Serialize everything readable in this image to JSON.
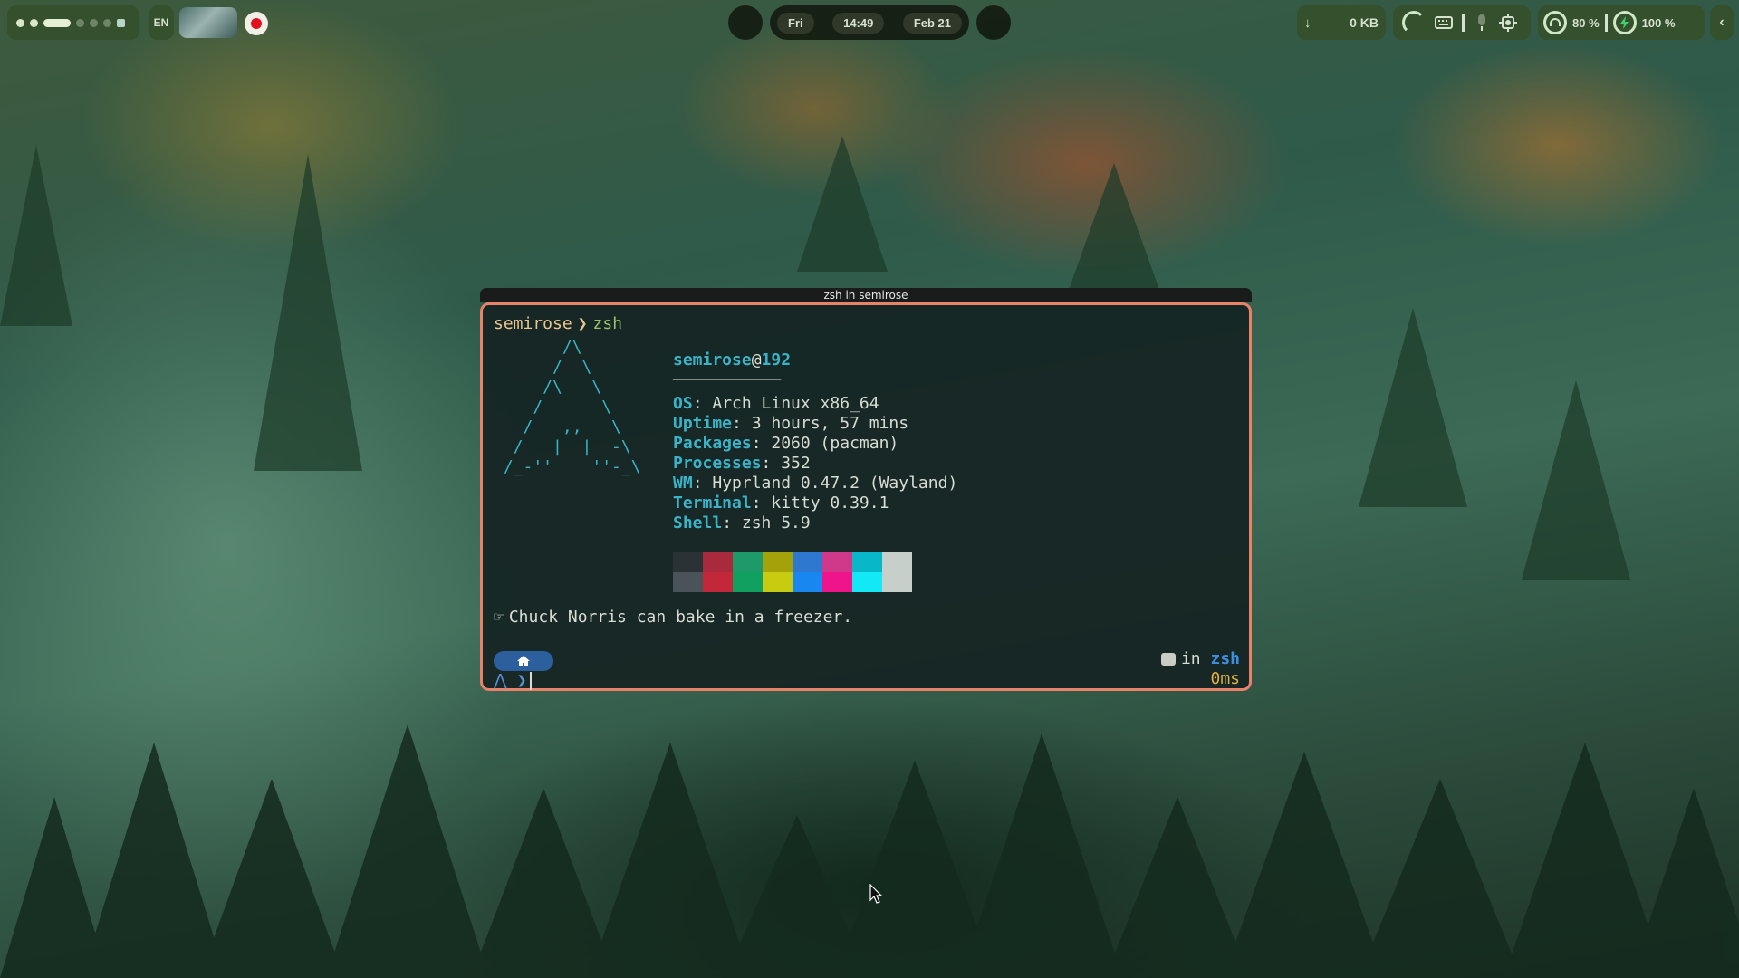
{
  "topbar": {
    "lang": "EN",
    "clock": {
      "day": "Fri",
      "time": "14:49",
      "date": "Feb 21"
    },
    "net_speed": "0 KB",
    "volume": "80 %",
    "battery": "100 %"
  },
  "terminal": {
    "title": "zsh in semirose",
    "cwd_user": "semirose",
    "cwd_shell": "zsh",
    "host_user": "semirose",
    "host_at": "@",
    "host_name": "192",
    "rule": "───────────",
    "info": [
      {
        "key": "OS",
        "value": ": Arch Linux x86_64"
      },
      {
        "key": "Uptime",
        "value": ": 3 hours, 57 mins"
      },
      {
        "key": "Packages",
        "value": ": 2060 (pacman)"
      },
      {
        "key": "Processes",
        "value": ": 352"
      },
      {
        "key": "WM",
        "value": ": Hyprland 0.47.2 (Wayland)"
      },
      {
        "key": "Terminal",
        "value": ": kitty 0.39.1"
      },
      {
        "key": "Shell",
        "value": ": zsh 5.9"
      }
    ],
    "palette_top": [
      "#2a3236",
      "#a92a3c",
      "#1e9a6a",
      "#a3a20a",
      "#2f78d0",
      "#d0388a",
      "#08b8c8",
      "#c7cfcb"
    ],
    "palette_bottom": [
      "#4a5458",
      "#c3283a",
      "#10a060",
      "#c8cc10",
      "#1888f0",
      "#f0148a",
      "#12e8f6",
      "#c7cfcb"
    ],
    "joke": "Chuck Norris can bake in a freezer.",
    "rprompt_in": "in",
    "rprompt_shell": "zsh",
    "rprompt_time": "0ms"
  }
}
